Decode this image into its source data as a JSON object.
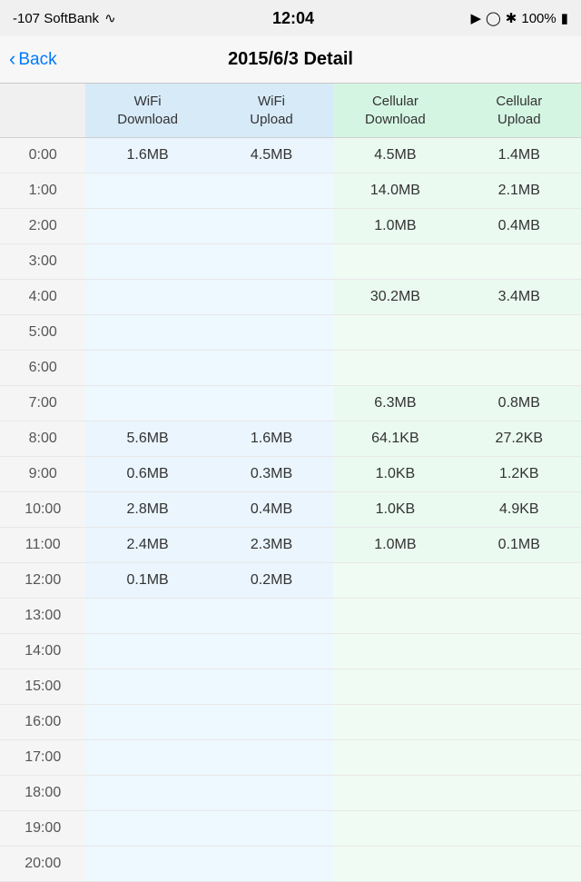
{
  "statusBar": {
    "carrier": "-107 SoftBank",
    "time": "12:04",
    "battery": "100%"
  },
  "nav": {
    "backLabel": "Back",
    "title": "2015/6/3 Detail"
  },
  "table": {
    "headers": {
      "time": "",
      "wifiDownload": "WiFi\nDownload",
      "wifiUpload": "WiFi\nUpload",
      "cellDownload": "Cellular\nDownload",
      "cellUpload": "Cellular\nUpload"
    },
    "rows": [
      {
        "time": "0:00",
        "wifiDown": "1.6MB",
        "wifiUp": "4.5MB",
        "cellDown": "4.5MB",
        "cellUp": "1.4MB"
      },
      {
        "time": "1:00",
        "wifiDown": "",
        "wifiUp": "",
        "cellDown": "14.0MB",
        "cellUp": "2.1MB"
      },
      {
        "time": "2:00",
        "wifiDown": "",
        "wifiUp": "",
        "cellDown": "1.0MB",
        "cellUp": "0.4MB"
      },
      {
        "time": "3:00",
        "wifiDown": "",
        "wifiUp": "",
        "cellDown": "",
        "cellUp": ""
      },
      {
        "time": "4:00",
        "wifiDown": "",
        "wifiUp": "",
        "cellDown": "30.2MB",
        "cellUp": "3.4MB"
      },
      {
        "time": "5:00",
        "wifiDown": "",
        "wifiUp": "",
        "cellDown": "",
        "cellUp": ""
      },
      {
        "time": "6:00",
        "wifiDown": "",
        "wifiUp": "",
        "cellDown": "",
        "cellUp": ""
      },
      {
        "time": "7:00",
        "wifiDown": "",
        "wifiUp": "",
        "cellDown": "6.3MB",
        "cellUp": "0.8MB"
      },
      {
        "time": "8:00",
        "wifiDown": "5.6MB",
        "wifiUp": "1.6MB",
        "cellDown": "64.1KB",
        "cellUp": "27.2KB"
      },
      {
        "time": "9:00",
        "wifiDown": "0.6MB",
        "wifiUp": "0.3MB",
        "cellDown": "1.0KB",
        "cellUp": "1.2KB"
      },
      {
        "time": "10:00",
        "wifiDown": "2.8MB",
        "wifiUp": "0.4MB",
        "cellDown": "1.0KB",
        "cellUp": "4.9KB"
      },
      {
        "time": "11:00",
        "wifiDown": "2.4MB",
        "wifiUp": "2.3MB",
        "cellDown": "1.0MB",
        "cellUp": "0.1MB"
      },
      {
        "time": "12:00",
        "wifiDown": "0.1MB",
        "wifiUp": "0.2MB",
        "cellDown": "",
        "cellUp": ""
      },
      {
        "time": "13:00",
        "wifiDown": "",
        "wifiUp": "",
        "cellDown": "",
        "cellUp": ""
      },
      {
        "time": "14:00",
        "wifiDown": "",
        "wifiUp": "",
        "cellDown": "",
        "cellUp": ""
      },
      {
        "time": "15:00",
        "wifiDown": "",
        "wifiUp": "",
        "cellDown": "",
        "cellUp": ""
      },
      {
        "time": "16:00",
        "wifiDown": "",
        "wifiUp": "",
        "cellDown": "",
        "cellUp": ""
      },
      {
        "time": "17:00",
        "wifiDown": "",
        "wifiUp": "",
        "cellDown": "",
        "cellUp": ""
      },
      {
        "time": "18:00",
        "wifiDown": "",
        "wifiUp": "",
        "cellDown": "",
        "cellUp": ""
      },
      {
        "time": "19:00",
        "wifiDown": "",
        "wifiUp": "",
        "cellDown": "",
        "cellUp": ""
      },
      {
        "time": "20:00",
        "wifiDown": "",
        "wifiUp": "",
        "cellDown": "",
        "cellUp": ""
      }
    ]
  }
}
